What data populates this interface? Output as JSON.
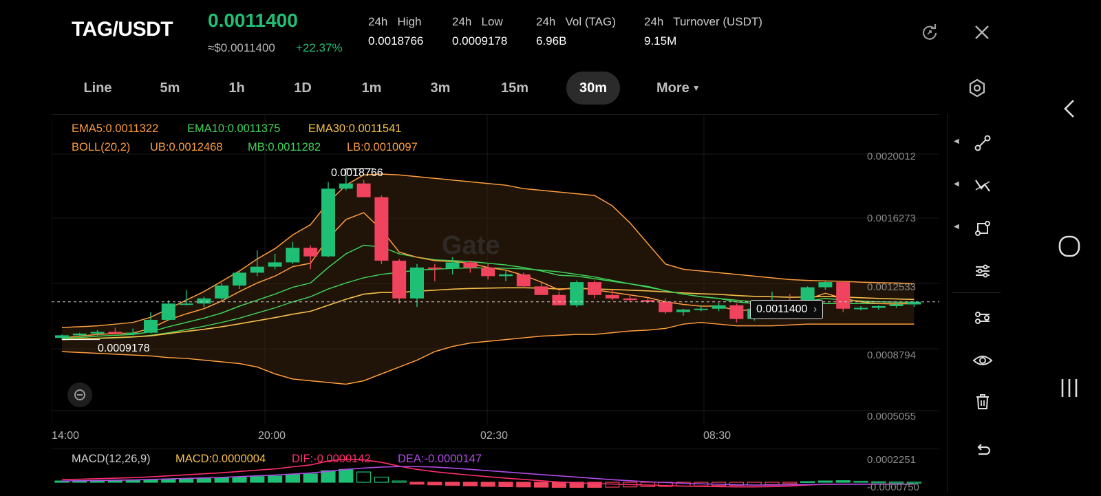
{
  "header": {
    "pair": "TAG/USDT",
    "last_price": "0.0011400",
    "usd_price": "≈$0.0011400",
    "change": "+22.37%",
    "stats": [
      {
        "label": "24h   High",
        "value": "0.0018766"
      },
      {
        "label": "24h   Low",
        "value": "0.0009178"
      },
      {
        "label": "24h   Vol (TAG)",
        "value": "6.96B"
      },
      {
        "label": "24h   Turnover (USDT)",
        "value": "9.15M"
      }
    ]
  },
  "timeframes": [
    "Line",
    "5m",
    "1h",
    "1D",
    "1m",
    "3m",
    "15m",
    "30m"
  ],
  "active_timeframe": "30m",
  "more_label": "More",
  "indicators": {
    "ema5": "EMA5:0.0011322",
    "ema10": "EMA10:0.0011375",
    "ema30": "EMA30:0.0011541",
    "boll": "BOLL(20,2)",
    "ub": "UB:0.0012468",
    "mb": "MB:0.0011282",
    "lb": "LB:0.0010097"
  },
  "price_axis": [
    "0.0020012",
    "0.0016273",
    "0.0012533",
    "0.0008794",
    "0.0005055"
  ],
  "time_axis": [
    "14:00",
    "20:00",
    "02:30",
    "08:30"
  ],
  "high_marker": "0.0018766",
  "low_marker": "0.0009178",
  "current_price_tag": "0.0011400",
  "watermark": "Gate",
  "macd": {
    "label": "MACD(12,26,9)",
    "macd": "MACD:0.0000004",
    "dif": "DIF:-0.0000142",
    "dea": "DEA:-0.0000147",
    "axis": [
      "0.0002251",
      "-0.0000750"
    ]
  },
  "colors": {
    "up": "#1fbf75",
    "down": "#f0435e",
    "ema5": "#ff9e3d",
    "ema10": "#3fd35a",
    "ema30": "#f6c04a",
    "boll": "#ff9e3d",
    "dif": "#ff2e6d",
    "dea": "#b04ce6"
  },
  "toolbar_icons": [
    "line-tool-icon",
    "trend-tool-icon",
    "shape-tool-icon",
    "settings-sliders-icon",
    "indicator-icon",
    "visibility-icon",
    "delete-icon",
    "undo-icon"
  ],
  "chart_data": {
    "type": "candlestick",
    "interval": "30m",
    "candles": [
      {
        "o": 0.00093,
        "h": 0.00095,
        "l": 0.00092,
        "c": 0.000945
      },
      {
        "o": 0.000945,
        "h": 0.00096,
        "l": 0.00093,
        "c": 0.000955
      },
      {
        "o": 0.000955,
        "h": 0.000975,
        "l": 0.00094,
        "c": 0.000965
      },
      {
        "o": 0.000965,
        "h": 0.00099,
        "l": 0.000955,
        "c": 0.000955
      },
      {
        "o": 0.000955,
        "h": 0.000985,
        "l": 0.000945,
        "c": 0.00096
      },
      {
        "o": 0.00096,
        "h": 0.00108,
        "l": 0.000955,
        "c": 0.001035
      },
      {
        "o": 0.001035,
        "h": 0.00115,
        "l": 0.00103,
        "c": 0.00113
      },
      {
        "o": 0.00113,
        "h": 0.00121,
        "l": 0.00112,
        "c": 0.00113
      },
      {
        "o": 0.00113,
        "h": 0.00117,
        "l": 0.00111,
        "c": 0.00116
      },
      {
        "o": 0.00116,
        "h": 0.00125,
        "l": 0.00115,
        "c": 0.001235
      },
      {
        "o": 0.001235,
        "h": 0.00132,
        "l": 0.001215,
        "c": 0.00131
      },
      {
        "o": 0.00131,
        "h": 0.00144,
        "l": 0.00129,
        "c": 0.001345
      },
      {
        "o": 0.001345,
        "h": 0.00142,
        "l": 0.00133,
        "c": 0.00137
      },
      {
        "o": 0.00137,
        "h": 0.00149,
        "l": 0.00136,
        "c": 0.001455
      },
      {
        "o": 0.001455,
        "h": 0.00147,
        "l": 0.00133,
        "c": 0.001405
      },
      {
        "o": 0.001405,
        "h": 0.00184,
        "l": 0.0014,
        "c": 0.0018
      },
      {
        "o": 0.0018,
        "h": 0.001877,
        "l": 0.00179,
        "c": 0.00183
      },
      {
        "o": 0.00183,
        "h": 0.00185,
        "l": 0.00175,
        "c": 0.00175
      },
      {
        "o": 0.00175,
        "h": 0.00176,
        "l": 0.00136,
        "c": 0.00138
      },
      {
        "o": 0.00138,
        "h": 0.00139,
        "l": 0.00113,
        "c": 0.00116
      },
      {
        "o": 0.00116,
        "h": 0.00136,
        "l": 0.00111,
        "c": 0.00134
      },
      {
        "o": 0.00134,
        "h": 0.00136,
        "l": 0.00126,
        "c": 0.001335
      },
      {
        "o": 0.001335,
        "h": 0.0014,
        "l": 0.0013,
        "c": 0.00137
      },
      {
        "o": 0.00137,
        "h": 0.00138,
        "l": 0.00131,
        "c": 0.00134
      },
      {
        "o": 0.00134,
        "h": 0.00136,
        "l": 0.00127,
        "c": 0.00129
      },
      {
        "o": 0.00129,
        "h": 0.00132,
        "l": 0.00126,
        "c": 0.0013
      },
      {
        "o": 0.0013,
        "h": 0.00131,
        "l": 0.00122,
        "c": 0.00123
      },
      {
        "o": 0.00123,
        "h": 0.00126,
        "l": 0.00118,
        "c": 0.00118
      },
      {
        "o": 0.00118,
        "h": 0.0012,
        "l": 0.00112,
        "c": 0.00112
      },
      {
        "o": 0.00112,
        "h": 0.001265,
        "l": 0.00111,
        "c": 0.001255
      },
      {
        "o": 0.001255,
        "h": 0.001265,
        "l": 0.00116,
        "c": 0.00118
      },
      {
        "o": 0.00118,
        "h": 0.00121,
        "l": 0.00115,
        "c": 0.00116
      },
      {
        "o": 0.00116,
        "h": 0.00118,
        "l": 0.00114,
        "c": 0.00115
      },
      {
        "o": 0.00115,
        "h": 0.001165,
        "l": 0.00113,
        "c": 0.00114
      },
      {
        "o": 0.00114,
        "h": 0.00116,
        "l": 0.00107,
        "c": 0.00108
      },
      {
        "o": 0.00108,
        "h": 0.0011,
        "l": 0.00106,
        "c": 0.001095
      },
      {
        "o": 0.001095,
        "h": 0.00112,
        "l": 0.001085,
        "c": 0.0011
      },
      {
        "o": 0.0011,
        "h": 0.001135,
        "l": 0.001085,
        "c": 0.00112
      },
      {
        "o": 0.00112,
        "h": 0.00113,
        "l": 0.00102,
        "c": 0.00104
      },
      {
        "o": 0.00104,
        "h": 0.00111,
        "l": 0.00103,
        "c": 0.0011
      },
      {
        "o": 0.0011,
        "h": 0.0012,
        "l": 0.00109,
        "c": 0.00114
      },
      {
        "o": 0.00114,
        "h": 0.001185,
        "l": 0.00112,
        "c": 0.001135
      },
      {
        "o": 0.001135,
        "h": 0.00123,
        "l": 0.00112,
        "c": 0.001225
      },
      {
        "o": 0.001225,
        "h": 0.00126,
        "l": 0.00121,
        "c": 0.001255
      },
      {
        "o": 0.001255,
        "h": 0.00126,
        "l": 0.00108,
        "c": 0.0011
      },
      {
        "o": 0.0011,
        "h": 0.001115,
        "l": 0.00109,
        "c": 0.001105
      },
      {
        "o": 0.001105,
        "h": 0.00112,
        "l": 0.001095,
        "c": 0.001115
      },
      {
        "o": 0.001115,
        "h": 0.00114,
        "l": 0.001105,
        "c": 0.001125
      },
      {
        "o": 0.001125,
        "h": 0.001145,
        "l": 0.00111,
        "c": 0.00114
      }
    ],
    "ema5": [
      0.00093,
      0.00094,
      0.00095,
      0.000955,
      0.000958,
      0.000985,
      0.001035,
      0.00107,
      0.0011,
      0.001145,
      0.0012,
      0.00125,
      0.00129,
      0.001345,
      0.001365,
      0.00151,
      0.00162,
      0.00166,
      0.00156,
      0.00143,
      0.0014,
      0.00138,
      0.001375,
      0.001365,
      0.00134,
      0.001325,
      0.001295,
      0.001255,
      0.00121,
      0.001225,
      0.00121,
      0.001195,
      0.00118,
      0.001165,
      0.00114,
      0.001125,
      0.001115,
      0.001115,
      0.00109,
      0.001093,
      0.00111,
      0.001118,
      0.001155,
      0.00119,
      0.00116,
      0.00114,
      0.00113,
      0.001128,
      0.001132
    ],
    "ema10": [
      0.000925,
      0.000932,
      0.00094,
      0.000945,
      0.00095,
      0.000965,
      0.000995,
      0.00102,
      0.001045,
      0.001075,
      0.001115,
      0.00115,
      0.001185,
      0.001225,
      0.00125,
      0.00134,
      0.00142,
      0.00147,
      0.00146,
      0.00142,
      0.0014,
      0.001385,
      0.00138,
      0.001375,
      0.001365,
      0.001355,
      0.00134,
      0.00132,
      0.001295,
      0.00129,
      0.001275,
      0.00126,
      0.001245,
      0.00123,
      0.001205,
      0.001185,
      0.00117,
      0.00116,
      0.00114,
      0.00113,
      0.00113,
      0.00113,
      0.001145,
      0.00116,
      0.00115,
      0.001145,
      0.00114,
      0.001138,
      0.001137
    ],
    "ema30": [
      0.00092,
      0.000924,
      0.000928,
      0.000932,
      0.000936,
      0.000942,
      0.000955,
      0.000968,
      0.00098,
      0.000995,
      0.001012,
      0.00103,
      0.001048,
      0.001068,
      0.001085,
      0.00112,
      0.001155,
      0.001185,
      0.001195,
      0.001195,
      0.001202,
      0.001208,
      0.001214,
      0.001218,
      0.00122,
      0.001222,
      0.001222,
      0.00122,
      0.001215,
      0.001218,
      0.001215,
      0.001212,
      0.001208,
      0.001204,
      0.001198,
      0.001192,
      0.001187,
      0.001184,
      0.001177,
      0.001172,
      0.00117,
      0.001167,
      0.001168,
      0.001172,
      0.001168,
      0.001164,
      0.00116,
      0.001157,
      0.001154
    ],
    "boll_ub": [
      0.00099,
      0.000995,
      0.001,
      0.00101,
      0.00102,
      0.00105,
      0.0011,
      0.00115,
      0.0012,
      0.00126,
      0.00132,
      0.00139,
      0.00145,
      0.00153,
      0.00159,
      0.00172,
      0.00182,
      0.00188,
      0.001885,
      0.00188,
      0.00187,
      0.00186,
      0.00185,
      0.00184,
      0.00183,
      0.00182,
      0.0018,
      0.00179,
      0.00178,
      0.00177,
      0.00176,
      0.0017,
      0.0016,
      0.00148,
      0.00136,
      0.00133,
      0.00132,
      0.00131,
      0.0013,
      0.00129,
      0.00128,
      0.00127,
      0.001265,
      0.001262,
      0.00126,
      0.001255,
      0.001252,
      0.00125,
      0.001247
    ],
    "boll_mb": [
      0.00092,
      0.000923,
      0.000926,
      0.00093,
      0.000935,
      0.000945,
      0.00096,
      0.000978,
      0.000998,
      0.00102,
      0.001045,
      0.001075,
      0.001105,
      0.00114,
      0.00117,
      0.001215,
      0.00125,
      0.00128,
      0.0013,
      0.001312,
      0.001325,
      0.00133,
      0.001335,
      0.001338,
      0.001338,
      0.001336,
      0.001332,
      0.001325,
      0.001315,
      0.0013,
      0.001285,
      0.001265,
      0.001245,
      0.001225,
      0.001205,
      0.001185,
      0.00117,
      0.00116,
      0.00115,
      0.00114,
      0.001138,
      0.001135,
      0.001132,
      0.00113,
      0.00113,
      0.00113,
      0.00113,
      0.001129,
      0.001128
    ],
    "boll_lb": [
      0.00085,
      0.000845,
      0.00084,
      0.000835,
      0.00083,
      0.000825,
      0.000815,
      0.00081,
      0.0008,
      0.00079,
      0.00078,
      0.00076,
      0.00072,
      0.00069,
      0.00068,
      0.00067,
      0.00066,
      0.00068,
      0.00072,
      0.00076,
      0.0008,
      0.00085,
      0.00088,
      0.0009,
      0.00091,
      0.00092,
      0.00093,
      0.00094,
      0.000945,
      0.00095,
      0.00095,
      0.00096,
      0.00097,
      0.000975,
      0.000985,
      0.00101,
      0.00102,
      0.00101,
      0.001,
      0.001,
      0.001,
      0.001005,
      0.00101,
      0.00101,
      0.00101,
      0.00101,
      0.00101,
      0.00101,
      0.00101
    ],
    "macd_hist": [
      1e-05,
      1.2e-05,
      1.4e-05,
      1.6e-05,
      1.8e-05,
      2e-05,
      2.4e-05,
      2.8e-05,
      3.2e-05,
      3.6e-05,
      4e-05,
      4.4e-05,
      4.8e-05,
      6e-05,
      6.5e-05,
      9e-05,
      0.0001,
      8e-05,
      4e-05,
      1e-05,
      -1.5e-05,
      -2e-05,
      -2.4e-05,
      -2.8e-05,
      -3.2e-05,
      -3.4e-05,
      -3.6e-05,
      -3.8e-05,
      -4e-05,
      -4e-05,
      -4e-05,
      -3.8e-05,
      -3.6e-05,
      -3.4e-05,
      -3.2e-05,
      -3e-05,
      -2.8e-05,
      -2.6e-05,
      -2.4e-05,
      -2.2e-05,
      -1.8e-05,
      -1e-05,
      6e-06,
      1e-05,
      1.2e-05,
      8e-06,
      4e-06,
      2e-06,
      1e-06
    ],
    "macd_dif": [
      2e-05,
      2.4e-05,
      2.8e-05,
      3.2e-05,
      3.6e-05,
      4.2e-05,
      5e-05,
      5.8e-05,
      6.6e-05,
      7.4e-05,
      8.4e-05,
      9.4e-05,
      0.000104,
      0.00012,
      0.000135,
      0.000165,
      0.00018,
      0.000175,
      0.000155,
      0.000125,
      0.0001,
      8.2e-05,
      6.8e-05,
      5.5e-05,
      4.3e-05,
      3.2e-05,
      2.2e-05,
      1.2e-05,
      2e-06,
      -4e-06,
      -1e-05,
      -1.4e-05,
      -1.8e-05,
      -2.2e-05,
      -2.6e-05,
      -3e-05,
      -3.2e-05,
      -3.4e-05,
      -3.6e-05,
      -3.6e-05,
      -3.4e-05,
      -3e-05,
      -2.2e-05,
      -1.6e-05,
      -1.5e-05,
      -1.5e-05,
      -1.4e-05,
      -1.4e-05,
      -1.4e-05
    ],
    "macd_dea": [
      1e-05,
      1.2e-05,
      1.4e-05,
      1.6e-05,
      1.8e-05,
      2.2e-05,
      2.6e-05,
      3e-05,
      3.4e-05,
      3.8e-05,
      4.4e-05,
      5e-05,
      5.6e-05,
      6.4e-05,
      7.2e-05,
      8.5e-05,
      0.0001,
      0.00011,
      0.000118,
      0.000122,
      0.000122,
      0.000118,
      0.00011,
      0.0001,
      9e-05,
      8e-05,
      7e-05,
      6e-05,
      5e-05,
      4e-05,
      3e-05,
      2e-05,
      1.2e-05,
      4e-06,
      -2e-06,
      -8e-06,
      -1.2e-05,
      -1.6e-05,
      -2e-05,
      -2.2e-05,
      -2.2e-05,
      -2e-05,
      -1.8e-05,
      -1.6e-05,
      -1.5e-05,
      -1.5e-05,
      -1.5e-05,
      -1.5e-05,
      -1.5e-05
    ],
    "y_axis_range": [
      0.0005055,
      0.0020012
    ],
    "macd_axis_range": [
      -7.5e-05,
      0.0002251
    ]
  }
}
